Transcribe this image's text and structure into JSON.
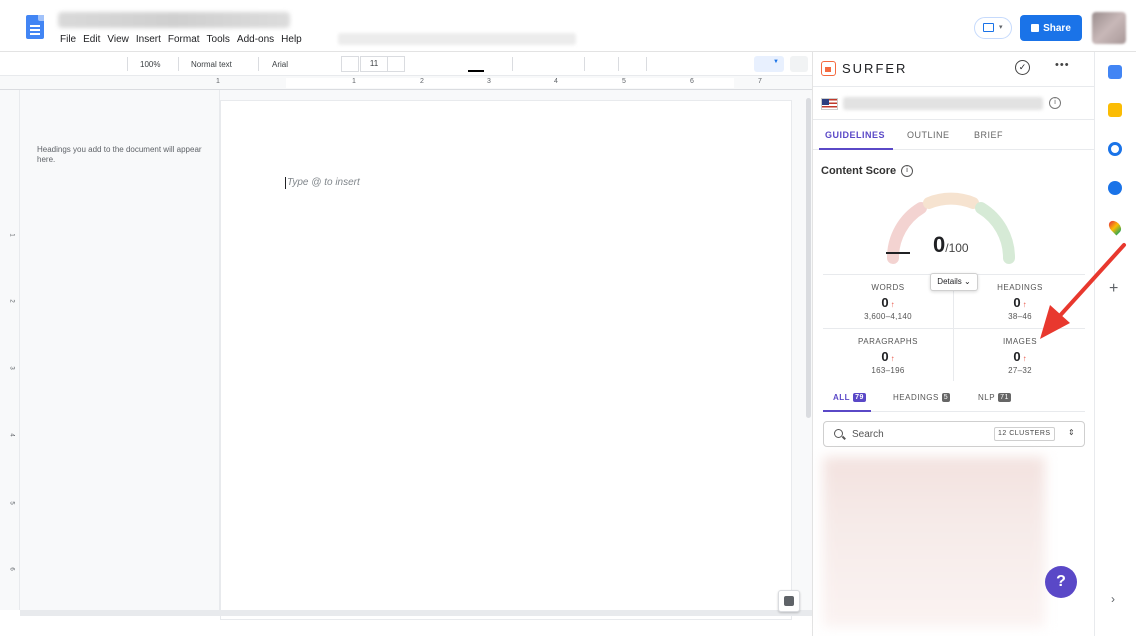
{
  "docs": {
    "menu": [
      "File",
      "Edit",
      "View",
      "Insert",
      "Format",
      "Tools",
      "Add-ons",
      "Help"
    ],
    "share_label": "Share",
    "toolbar": {
      "zoom": "100%",
      "style": "Normal text",
      "font": "Arial",
      "font_size": "11"
    },
    "ruler_numbers": [
      "1",
      "1",
      "2",
      "3",
      "4",
      "5",
      "6",
      "7"
    ],
    "vruler_numbers": [
      "1",
      "2",
      "3",
      "4",
      "5",
      "6"
    ],
    "outline_hint": "Headings you add to the document will appear here.",
    "placeholder": "Type @ to insert"
  },
  "surfer": {
    "brand": "SURFER",
    "tabs": [
      "GUIDELINES",
      "OUTLINE",
      "BRIEF"
    ],
    "active_tab": "GUIDELINES",
    "content_score_label": "Content Score",
    "score": "0",
    "score_max": "/100",
    "details_label": "Details",
    "stats": [
      {
        "label": "WORDS",
        "value": "0",
        "range": "3,600–4,140"
      },
      {
        "label": "HEADINGS",
        "value": "0",
        "range": "38–46"
      },
      {
        "label": "PARAGRAPHS",
        "value": "0",
        "range": "163–196"
      },
      {
        "label": "IMAGES",
        "value": "0",
        "range": "27–32"
      }
    ],
    "filter_tabs": [
      {
        "label": "ALL",
        "count": "79"
      },
      {
        "label": "HEADINGS",
        "count": "5"
      },
      {
        "label": "NLP",
        "count": "71"
      }
    ],
    "search_placeholder": "Search",
    "clusters": "12 CLUSTERS",
    "colors": {
      "accent": "#5a48c7",
      "brand": "#f46a40",
      "up_arrow": "#e74c3c",
      "annotation": "#e8382e"
    }
  }
}
